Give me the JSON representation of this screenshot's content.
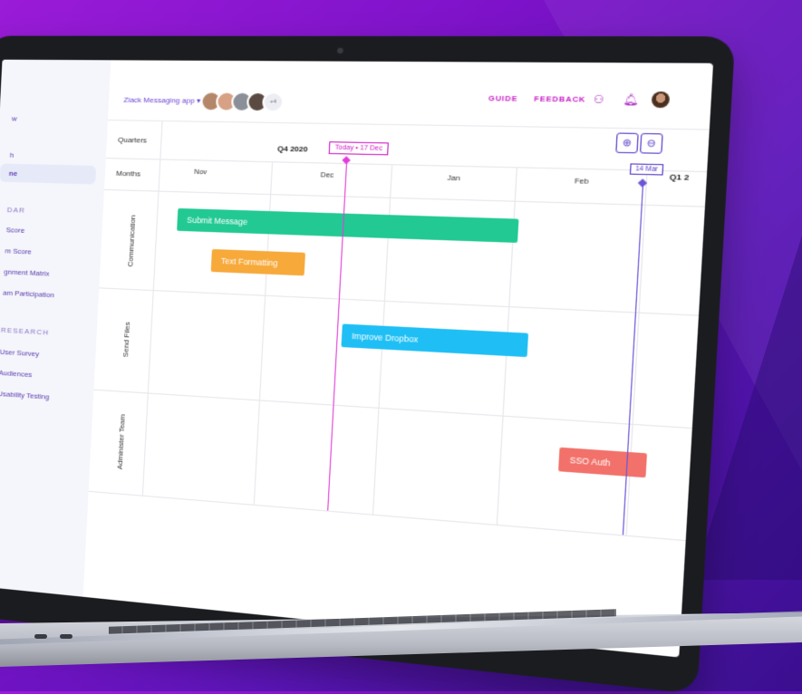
{
  "app": {
    "project_name": "Ziack Messaging app",
    "collaborator_count": "+4",
    "links": {
      "guide": "GUIDE",
      "feedback": "FEEDBACK"
    },
    "device_brand": "MacBook Pro"
  },
  "sidebar": {
    "items": [
      {
        "label": "w"
      },
      {
        "label": ""
      },
      {
        "label": "h"
      },
      {
        "label": "ne",
        "active": true
      }
    ],
    "section_dar": {
      "heading": "DAR",
      "items": [
        "Score",
        "m Score",
        "gnment Matrix",
        "am Participation"
      ]
    },
    "section_research": {
      "heading": "RESEARCH",
      "items": [
        "User Survey",
        "Audiences",
        "Usability Testing"
      ]
    }
  },
  "timeline": {
    "header_quarters_label": "Quarters",
    "header_months_label": "Months",
    "quarter_current": "Q4 2020",
    "quarter_next": "Q1 2",
    "today_tag": "Today • 17 Dec",
    "marker_tag": "14 Mar",
    "months": [
      "Nov",
      "Dec",
      "Jan",
      "Feb"
    ],
    "rows": [
      "Communication",
      "Send Files",
      "Administer Team"
    ],
    "bars": [
      {
        "label": "Submit Message",
        "color": "#22c993"
      },
      {
        "label": "Text Formatting",
        "color": "#f7a93a"
      },
      {
        "label": "Improve Dropbox",
        "color": "#1fbff5"
      },
      {
        "label": "SSO Auth",
        "color": "#f2716a"
      }
    ],
    "today_color": "#e33cd9",
    "marker_color": "#6c55d8"
  }
}
